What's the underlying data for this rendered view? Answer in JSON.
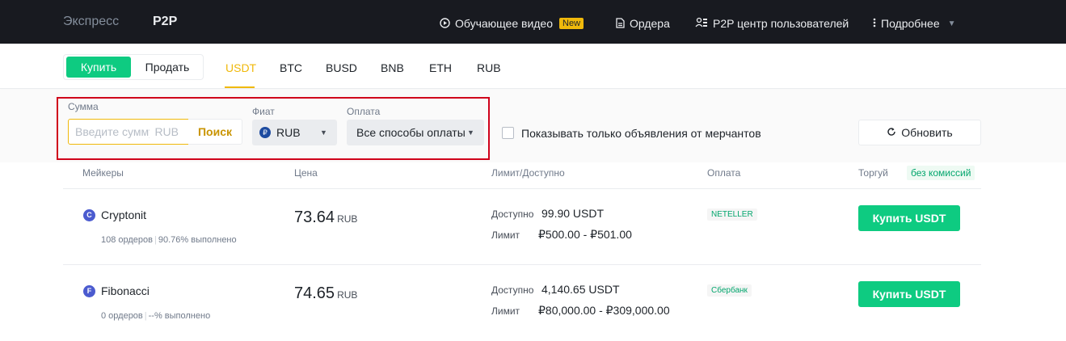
{
  "nav": {
    "express": "Экспресс",
    "p2p": "P2P",
    "video": "Обучающее видео",
    "new_badge": "New",
    "orders": "Ордера",
    "user_center": "P2P центр пользователей",
    "more": "Подробнее"
  },
  "subnav": {
    "buy": "Купить",
    "sell": "Продать",
    "assets": [
      "USDT",
      "BTC",
      "BUSD",
      "BNB",
      "ETH",
      "RUB"
    ],
    "active_asset": "USDT"
  },
  "filters": {
    "amount_label": "Сумма",
    "amount_placeholder": "Введите сумму",
    "amount_unit": "RUB",
    "search": "Поиск",
    "fiat_label": "Фиат",
    "fiat_symbol": "₽",
    "fiat_value": "RUB",
    "payment_label": "Оплата",
    "payment_value": "Все способы оплаты",
    "merchant_only": "Показывать только объявления от мерчантов",
    "refresh": "Обновить"
  },
  "table": {
    "headers": {
      "makers": "Мейкеры",
      "price": "Цена",
      "limit": "Лимит/Доступно",
      "payment": "Оплата",
      "trade": "Торгуй",
      "no_fee": "без комиссий"
    },
    "rows": [
      {
        "initial": "C",
        "name": "Cryptonit",
        "orders": "108 ордеров",
        "completion": "90.76% выполнено",
        "price": "73.64",
        "price_unit": "RUB",
        "available_label": "Доступно",
        "available": "99.90 USDT",
        "limit_label": "Лимит",
        "limit": "₽500.00 - ₽501.00",
        "payment": "NETELLER",
        "action": "Купить USDT"
      },
      {
        "initial": "F",
        "name": "Fibonacci",
        "orders": "0 ордеров",
        "completion": "--% выполнено",
        "price": "74.65",
        "price_unit": "RUB",
        "available_label": "Доступно",
        "available": "4,140.65 USDT",
        "limit_label": "Лимит",
        "limit": "₽80,000.00 - ₽309,000.00",
        "payment": "Сбербанк",
        "action": "Купить USDT"
      }
    ]
  },
  "colors": {
    "topbar": "#181a20",
    "accent": "#f0b90b",
    "buy_green": "#0ecb81",
    "highlight_red": "#d0021b"
  }
}
